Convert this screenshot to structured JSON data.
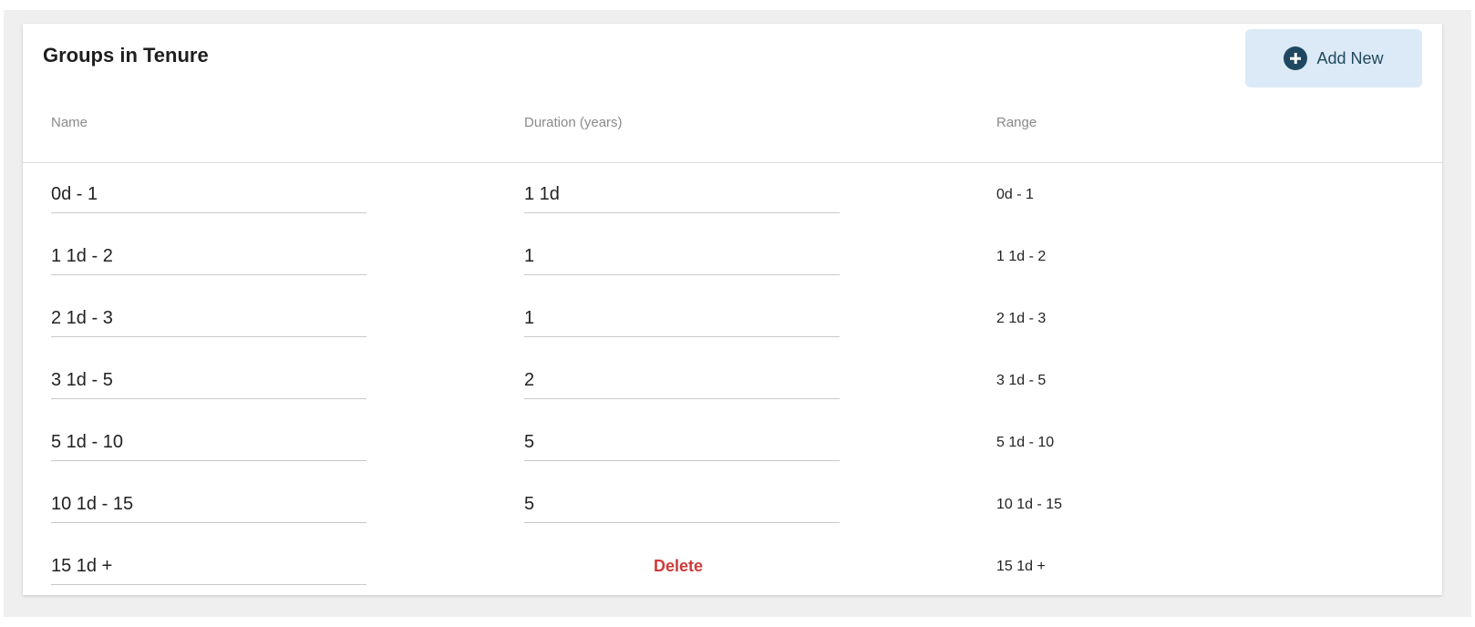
{
  "card": {
    "title": "Groups in Tenure",
    "add_label": "Add New"
  },
  "columns": {
    "name": "Name",
    "duration": "Duration (years)",
    "range": "Range"
  },
  "rows": [
    {
      "name": "0d - 1",
      "duration": "1 1d",
      "range": "0d - 1"
    },
    {
      "name": "1 1d - 2",
      "duration": "1",
      "range": "1 1d - 2"
    },
    {
      "name": "2 1d - 3",
      "duration": "1",
      "range": "2 1d - 3"
    },
    {
      "name": "3 1d - 5",
      "duration": "2",
      "range": "3 1d - 5"
    },
    {
      "name": "5 1d - 10",
      "duration": "5",
      "range": "5 1d - 10"
    },
    {
      "name": "10 1d - 15",
      "duration": "5",
      "range": "10 1d - 15"
    },
    {
      "name": "15 1d +",
      "delete_label": "Delete",
      "range": "15 1d +"
    }
  ],
  "icons": {
    "add": "plus-circle-icon"
  },
  "colors": {
    "add_button_bg": "#dbeaf6",
    "add_icon": "#1f4760",
    "delete": "#cf3a3a"
  }
}
